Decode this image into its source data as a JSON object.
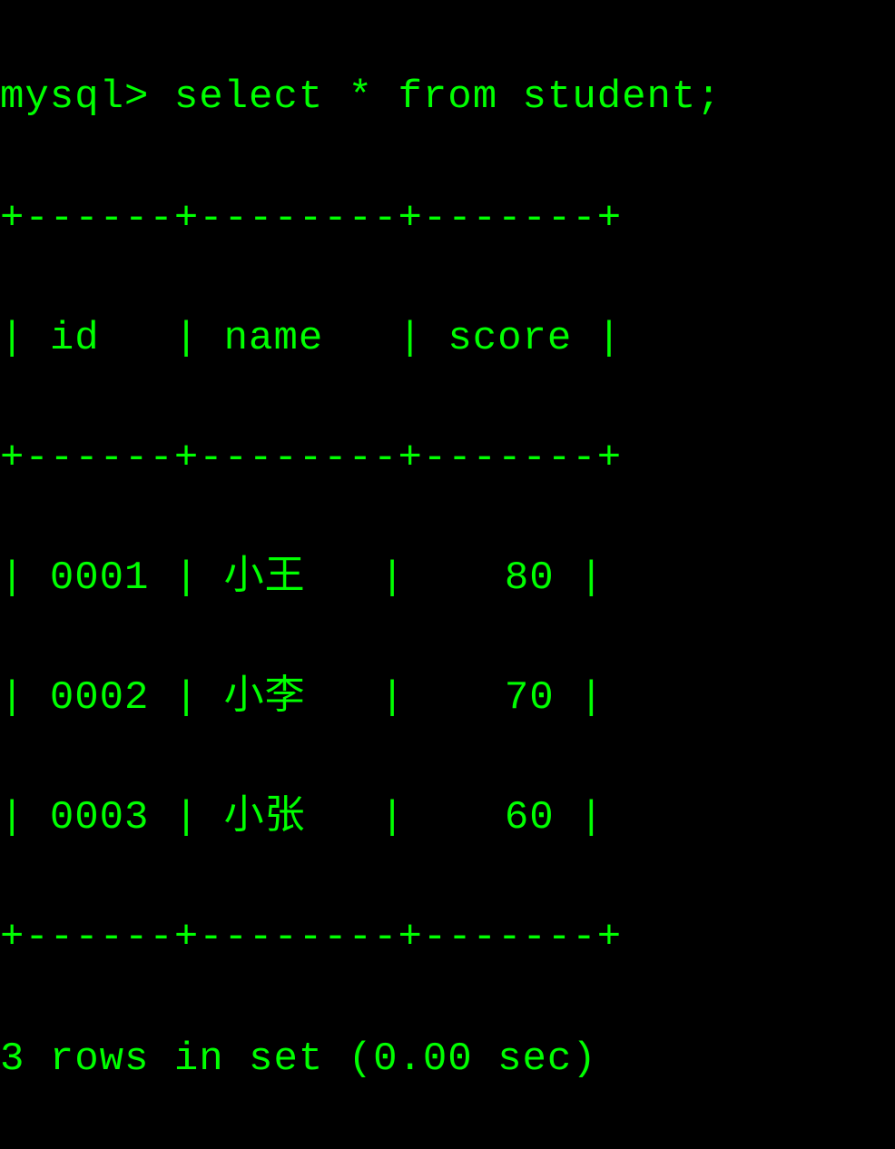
{
  "prompt": "mysql>",
  "query": "select * from student;",
  "table": {
    "borderTop": "+------+--------+-------+",
    "borderMid": "+------+--------+-------+",
    "borderBot": "+------+--------+-------+",
    "headers": {
      "col1": "id",
      "col2": "name",
      "col3": "score"
    },
    "rows": [
      {
        "id": "0001",
        "name": "小王",
        "score": "80"
      },
      {
        "id": "0002",
        "name": "小李",
        "score": "70"
      },
      {
        "id": "0003",
        "name": "小张",
        "score": "60"
      }
    ]
  },
  "status": "3 rows in set (0.00 sec)"
}
